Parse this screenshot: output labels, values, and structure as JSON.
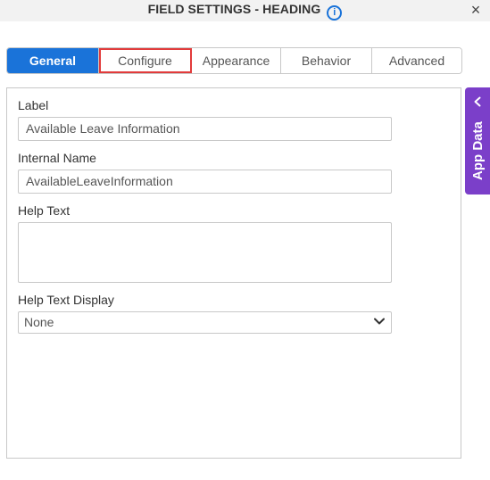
{
  "header": {
    "title": "FIELD SETTINGS - HEADING",
    "info_icon": "i",
    "close_icon": "×"
  },
  "tabs": [
    {
      "label": "General",
      "active": true
    },
    {
      "label": "Configure",
      "highlighted": true
    },
    {
      "label": "Appearance"
    },
    {
      "label": "Behavior"
    },
    {
      "label": "Advanced"
    }
  ],
  "form": {
    "label_title": "Label",
    "label_value": "Available Leave Information",
    "internal_name_title": "Internal Name",
    "internal_name_value": "AvailableLeaveInformation",
    "help_text_title": "Help Text",
    "help_text_value": "",
    "help_text_display_title": "Help Text Display",
    "help_text_display_value": "None"
  },
  "side_panel": {
    "label": "App Data"
  },
  "colors": {
    "accent": "#1a73d9",
    "side_panel": "#7b3fc9",
    "highlight": "#e23b3b"
  }
}
